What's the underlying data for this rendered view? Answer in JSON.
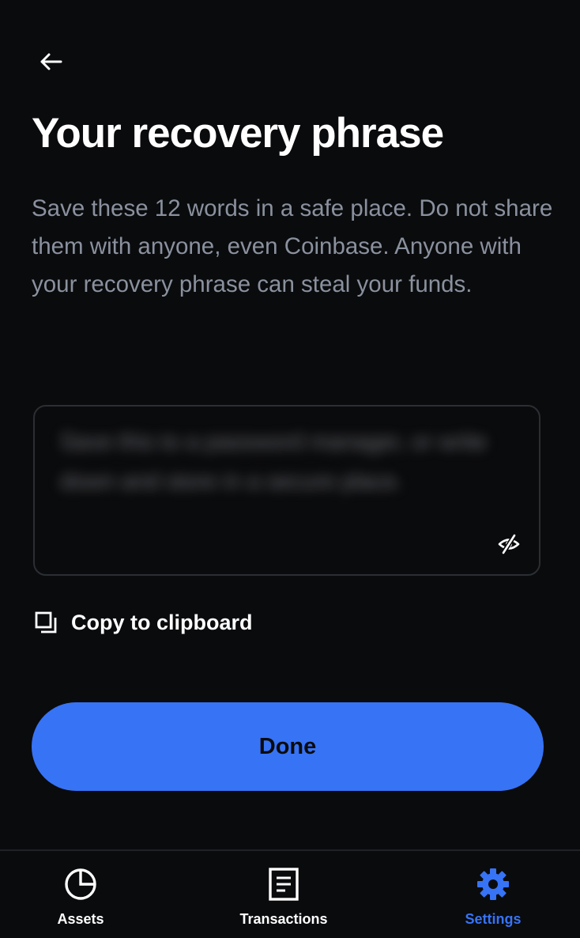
{
  "header": {
    "title": "Your recovery phrase"
  },
  "description": "Save these 12 words in a safe place. Do not share them with anyone, even Coinbase. Anyone with your recovery phrase can steal your funds.",
  "phrase_box": {
    "blurred_text": "Save this to a password manager, or write down and store in a secure place."
  },
  "copy": {
    "label": "Copy to clipboard"
  },
  "done_button": {
    "label": "Done"
  },
  "bottom_nav": {
    "items": [
      {
        "label": "Assets",
        "icon": "pie-chart-icon",
        "active": false
      },
      {
        "label": "Transactions",
        "icon": "document-icon",
        "active": false
      },
      {
        "label": "Settings",
        "icon": "gear-icon",
        "active": true
      }
    ]
  },
  "colors": {
    "background": "#0a0b0d",
    "accent": "#3773f5",
    "text_secondary": "#8a919e",
    "border": "#2b2e33"
  }
}
